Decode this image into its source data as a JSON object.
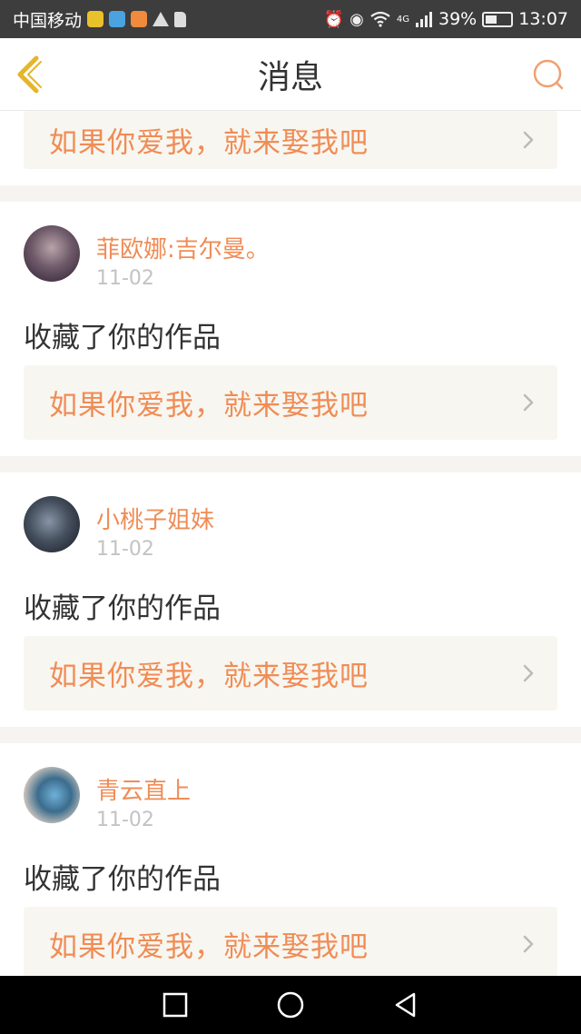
{
  "status_bar": {
    "carrier": "中国移动",
    "signal_label": "4G",
    "battery": "39%",
    "time": "13:07"
  },
  "header": {
    "title": "消息"
  },
  "partial_card": {
    "work_title": "如果你爱我，就来娶我吧"
  },
  "messages": [
    {
      "username": "菲欧娜:吉尔曼。",
      "date": "11-02",
      "action": "收藏了你的作品",
      "work_title": "如果你爱我，就来娶我吧"
    },
    {
      "username": "小桃子姐妹",
      "date": "11-02",
      "action": "收藏了你的作品",
      "work_title": "如果你爱我，就来娶我吧"
    },
    {
      "username": "青云直上",
      "date": "11-02",
      "action": "收藏了你的作品",
      "work_title": "如果你爱我，就来娶我吧"
    }
  ],
  "colors": {
    "accent": "#f08c55",
    "back_icon": "#e6b52a",
    "search_icon": "#f0a070"
  }
}
